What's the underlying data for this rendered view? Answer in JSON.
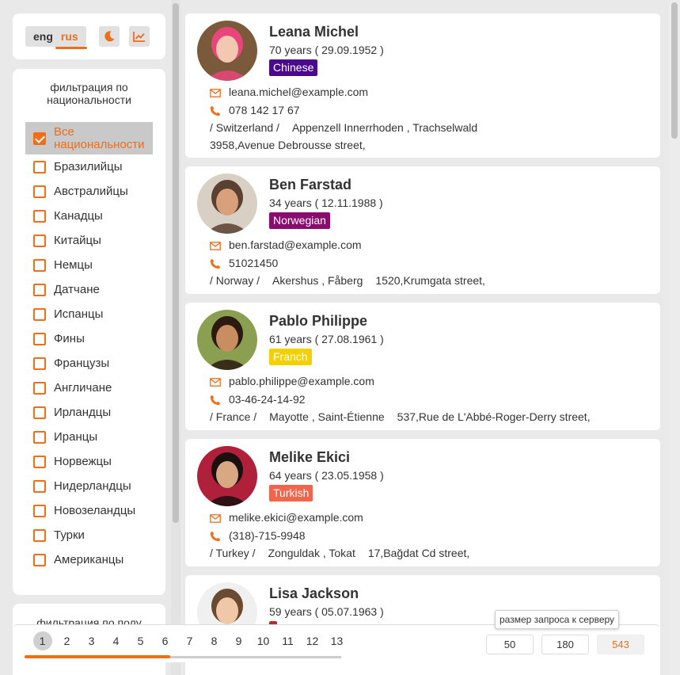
{
  "language": {
    "options": [
      "eng",
      "rus"
    ],
    "active": "rus"
  },
  "toolbar": {
    "theme_icon": "moon-icon",
    "stats_icon": "chart-line-icon"
  },
  "filters": {
    "nationality_title": "фильтрация по национальности",
    "nationalities": [
      {
        "label": "Все национальности",
        "checked": true
      },
      {
        "label": "Бразилийцы",
        "checked": false
      },
      {
        "label": "Австралийцы",
        "checked": false
      },
      {
        "label": "Канадцы",
        "checked": false
      },
      {
        "label": "Китайцы",
        "checked": false
      },
      {
        "label": "Немцы",
        "checked": false
      },
      {
        "label": "Датчане",
        "checked": false
      },
      {
        "label": "Испанцы",
        "checked": false
      },
      {
        "label": "Фины",
        "checked": false
      },
      {
        "label": "Французы",
        "checked": false
      },
      {
        "label": "Англичане",
        "checked": false
      },
      {
        "label": "Ирландцы",
        "checked": false
      },
      {
        "label": "Иранцы",
        "checked": false
      },
      {
        "label": "Норвежцы",
        "checked": false
      },
      {
        "label": "Нидерландцы",
        "checked": false
      },
      {
        "label": "Новозеландцы",
        "checked": false
      },
      {
        "label": "Турки",
        "checked": false
      },
      {
        "label": "Американцы",
        "checked": false
      }
    ],
    "gender_title": "фильтрация по полу"
  },
  "users": [
    {
      "name": "Leana Michel",
      "age": "70 years ( 29.09.1952 )",
      "nationality": "Chinese",
      "badge_color": "#4b0a8c",
      "email": "leana.michel@example.com",
      "phone": "078 142 17 67",
      "country": "/ Switzerland /",
      "region": "Appenzell Innerrhoden , Trachselwald",
      "street": "3958,Avenue Debrousse street,"
    },
    {
      "name": "Ben Farstad",
      "age": "34 years ( 12.11.1988 )",
      "nationality": "Norwegian",
      "badge_color": "#8a0c6e",
      "email": "ben.farstad@example.com",
      "phone": "51021450",
      "country": "/ Norway /",
      "region": "Akershus , Fåberg",
      "street": "1520,Krumgata street,"
    },
    {
      "name": "Pablo Philippe",
      "age": "61 years ( 27.08.1961 )",
      "nationality": "Franch",
      "badge_color": "#f5d000",
      "email": "pablo.philippe@example.com",
      "phone": "03-46-24-14-92",
      "country": "/ France /",
      "region": "Mayotte , Saint-Étienne",
      "street": "537,Rue de L'Abbé-Roger-Derry street,"
    },
    {
      "name": "Melike Ekici",
      "age": "64 years ( 23.05.1958 )",
      "nationality": "Turkish",
      "badge_color": "#f0654b",
      "email": "melike.ekici@example.com",
      "phone": "(318)-715-9948",
      "country": "/ Turkey /",
      "region": "Zonguldak , Tokat",
      "street": "17,Bağdat Cd street,"
    },
    {
      "name": "Lisa Jackson",
      "age": "59 years ( 05.07.1963 )",
      "nationality": "",
      "badge_color": "#b0302a",
      "email": "",
      "phone": "",
      "country": "",
      "region": "",
      "street": ""
    }
  ],
  "pagination": {
    "pages": [
      "1",
      "2",
      "3",
      "4",
      "5",
      "6",
      "7",
      "8",
      "9",
      "10",
      "11",
      "12",
      "13"
    ],
    "current": "1",
    "scroll_fraction": 0.46
  },
  "request_size": {
    "tooltip": "размер запроса к серверу",
    "options": [
      "50",
      "180",
      "543"
    ],
    "active": "543"
  },
  "colors": {
    "accent": "#f06d1a"
  }
}
